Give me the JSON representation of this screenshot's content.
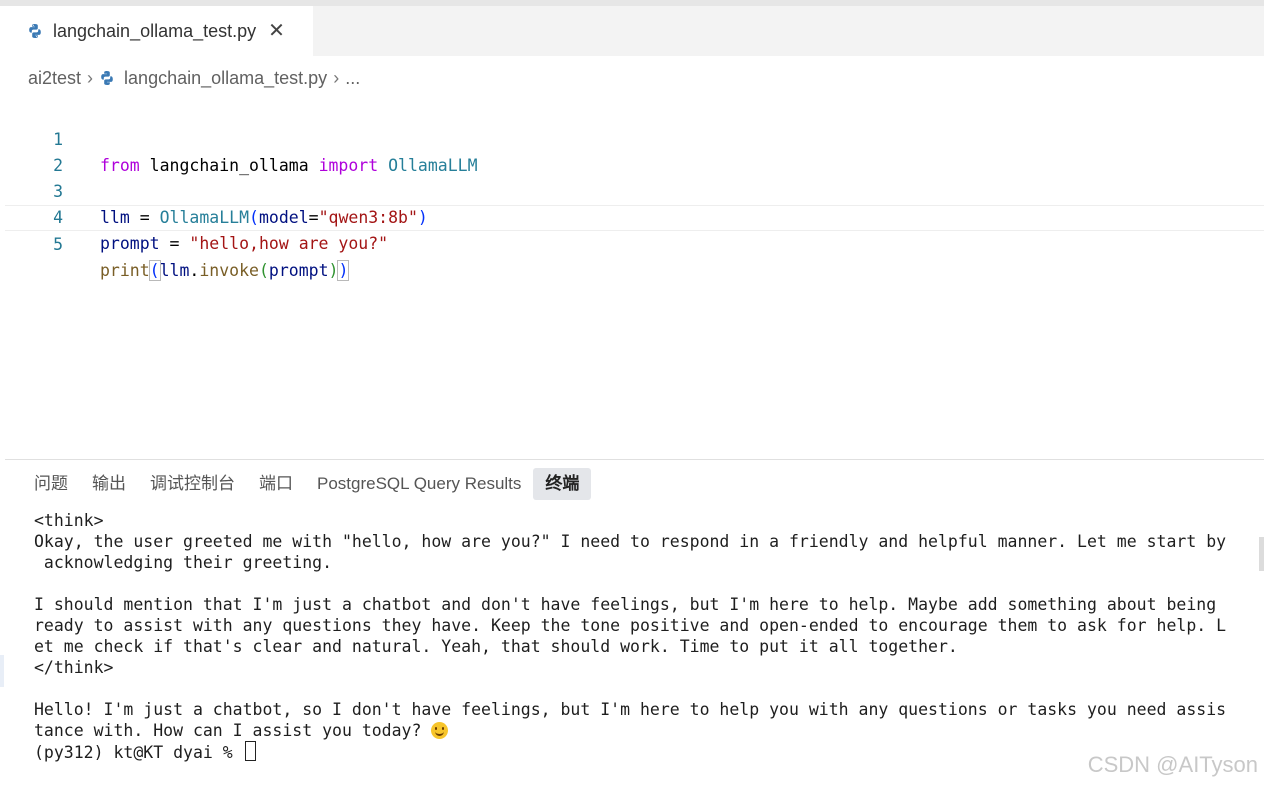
{
  "tab": {
    "filename": "langchain_ollama_test.py",
    "close_glyph": "✕"
  },
  "breadcrumb": {
    "folder": "ai2test",
    "file": "langchain_ollama_test.py",
    "more": "..."
  },
  "editor": {
    "line_numbers": [
      "1",
      "2",
      "3",
      "4",
      "5"
    ],
    "line1": {
      "kw_from": "from",
      "module": " langchain_ollama ",
      "kw_import": "import",
      "cls": " OllamaLLM"
    },
    "line3": {
      "var": "llm",
      "eq": " = ",
      "cls": "OllamaLLM",
      "open": "(",
      "param": "model",
      "eq2": "=",
      "str": "\"qwen3:8b\"",
      "close": ")"
    },
    "line4": {
      "var": "prompt",
      "eq": " = ",
      "str": "\"hello,how are you?\""
    },
    "line5": {
      "fn": "print",
      "open1": "(",
      "obj": "llm",
      "dot": ".",
      "method": "invoke",
      "open2": "(",
      "arg": "prompt",
      "close2": ")",
      "close1": ")"
    }
  },
  "panel": {
    "tabs": [
      "问题",
      "输出",
      "调试控制台",
      "端口",
      "PostgreSQL Query Results",
      "终端"
    ],
    "active_tab": "终端"
  },
  "terminal": {
    "lines": [
      "<think>",
      "Okay, the user greeted me with \"hello, how are you?\" I need to respond in a friendly and helpful manner. Let me start by",
      " acknowledging their greeting.",
      "",
      "I should mention that I'm just a chatbot and don't have feelings, but I'm here to help. Maybe add something about being",
      "ready to assist with any questions they have. Keep the tone positive and open-ended to encourage them to ask for help. L",
      "et me check if that's clear and natural. Yeah, that should work. Time to put it all together.",
      "</think>",
      "",
      "Hello! I'm just a chatbot, so I don't have feelings, but I'm here to help you with any questions or tasks you need assis"
    ],
    "last_line": "tance with. How can I assist you today? ",
    "prompt": "(py312) kt@KT dyai % "
  },
  "watermark": "CSDN @AITyson",
  "colors": {
    "keyword": "#af00db",
    "class": "#267f99",
    "variable": "#001080",
    "function": "#795e26",
    "string": "#a31515",
    "line_number": "#237893"
  }
}
